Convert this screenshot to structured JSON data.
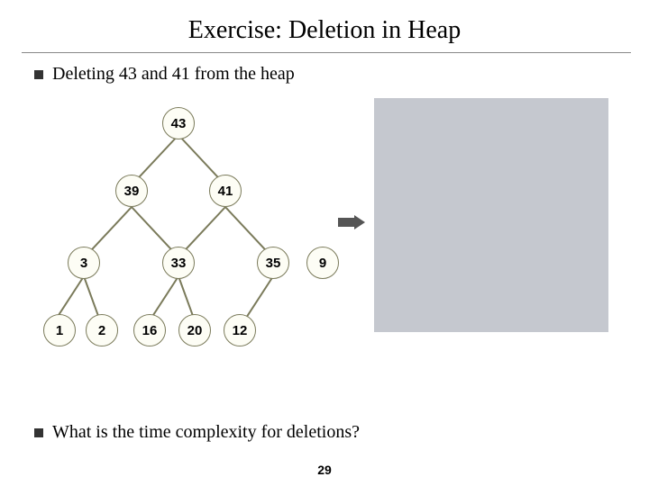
{
  "title": "Exercise: Deletion in Heap",
  "bullet1": "Deleting 43 and 41 from the heap",
  "bullet2": "What is the time complexity for deletions?",
  "page_number": "29",
  "nodes": {
    "n43": "43",
    "n39": "39",
    "n41": "41",
    "n3": "3",
    "n33": "33",
    "n35": "35",
    "n9": "9",
    "n1": "1",
    "n2": "2",
    "n16": "16",
    "n20": "20",
    "n12": "12"
  },
  "tree_structure": {
    "root": 43,
    "levels": [
      [
        43
      ],
      [
        39,
        41
      ],
      [
        3,
        33,
        35,
        9
      ],
      [
        1,
        2,
        16,
        20,
        12
      ]
    ],
    "edges": [
      [
        43,
        39
      ],
      [
        43,
        41
      ],
      [
        39,
        3
      ],
      [
        39,
        33
      ],
      [
        41,
        35
      ],
      [
        41,
        9
      ],
      [
        3,
        1
      ],
      [
        3,
        2
      ],
      [
        33,
        16
      ],
      [
        33,
        20
      ],
      [
        35,
        12
      ]
    ]
  }
}
